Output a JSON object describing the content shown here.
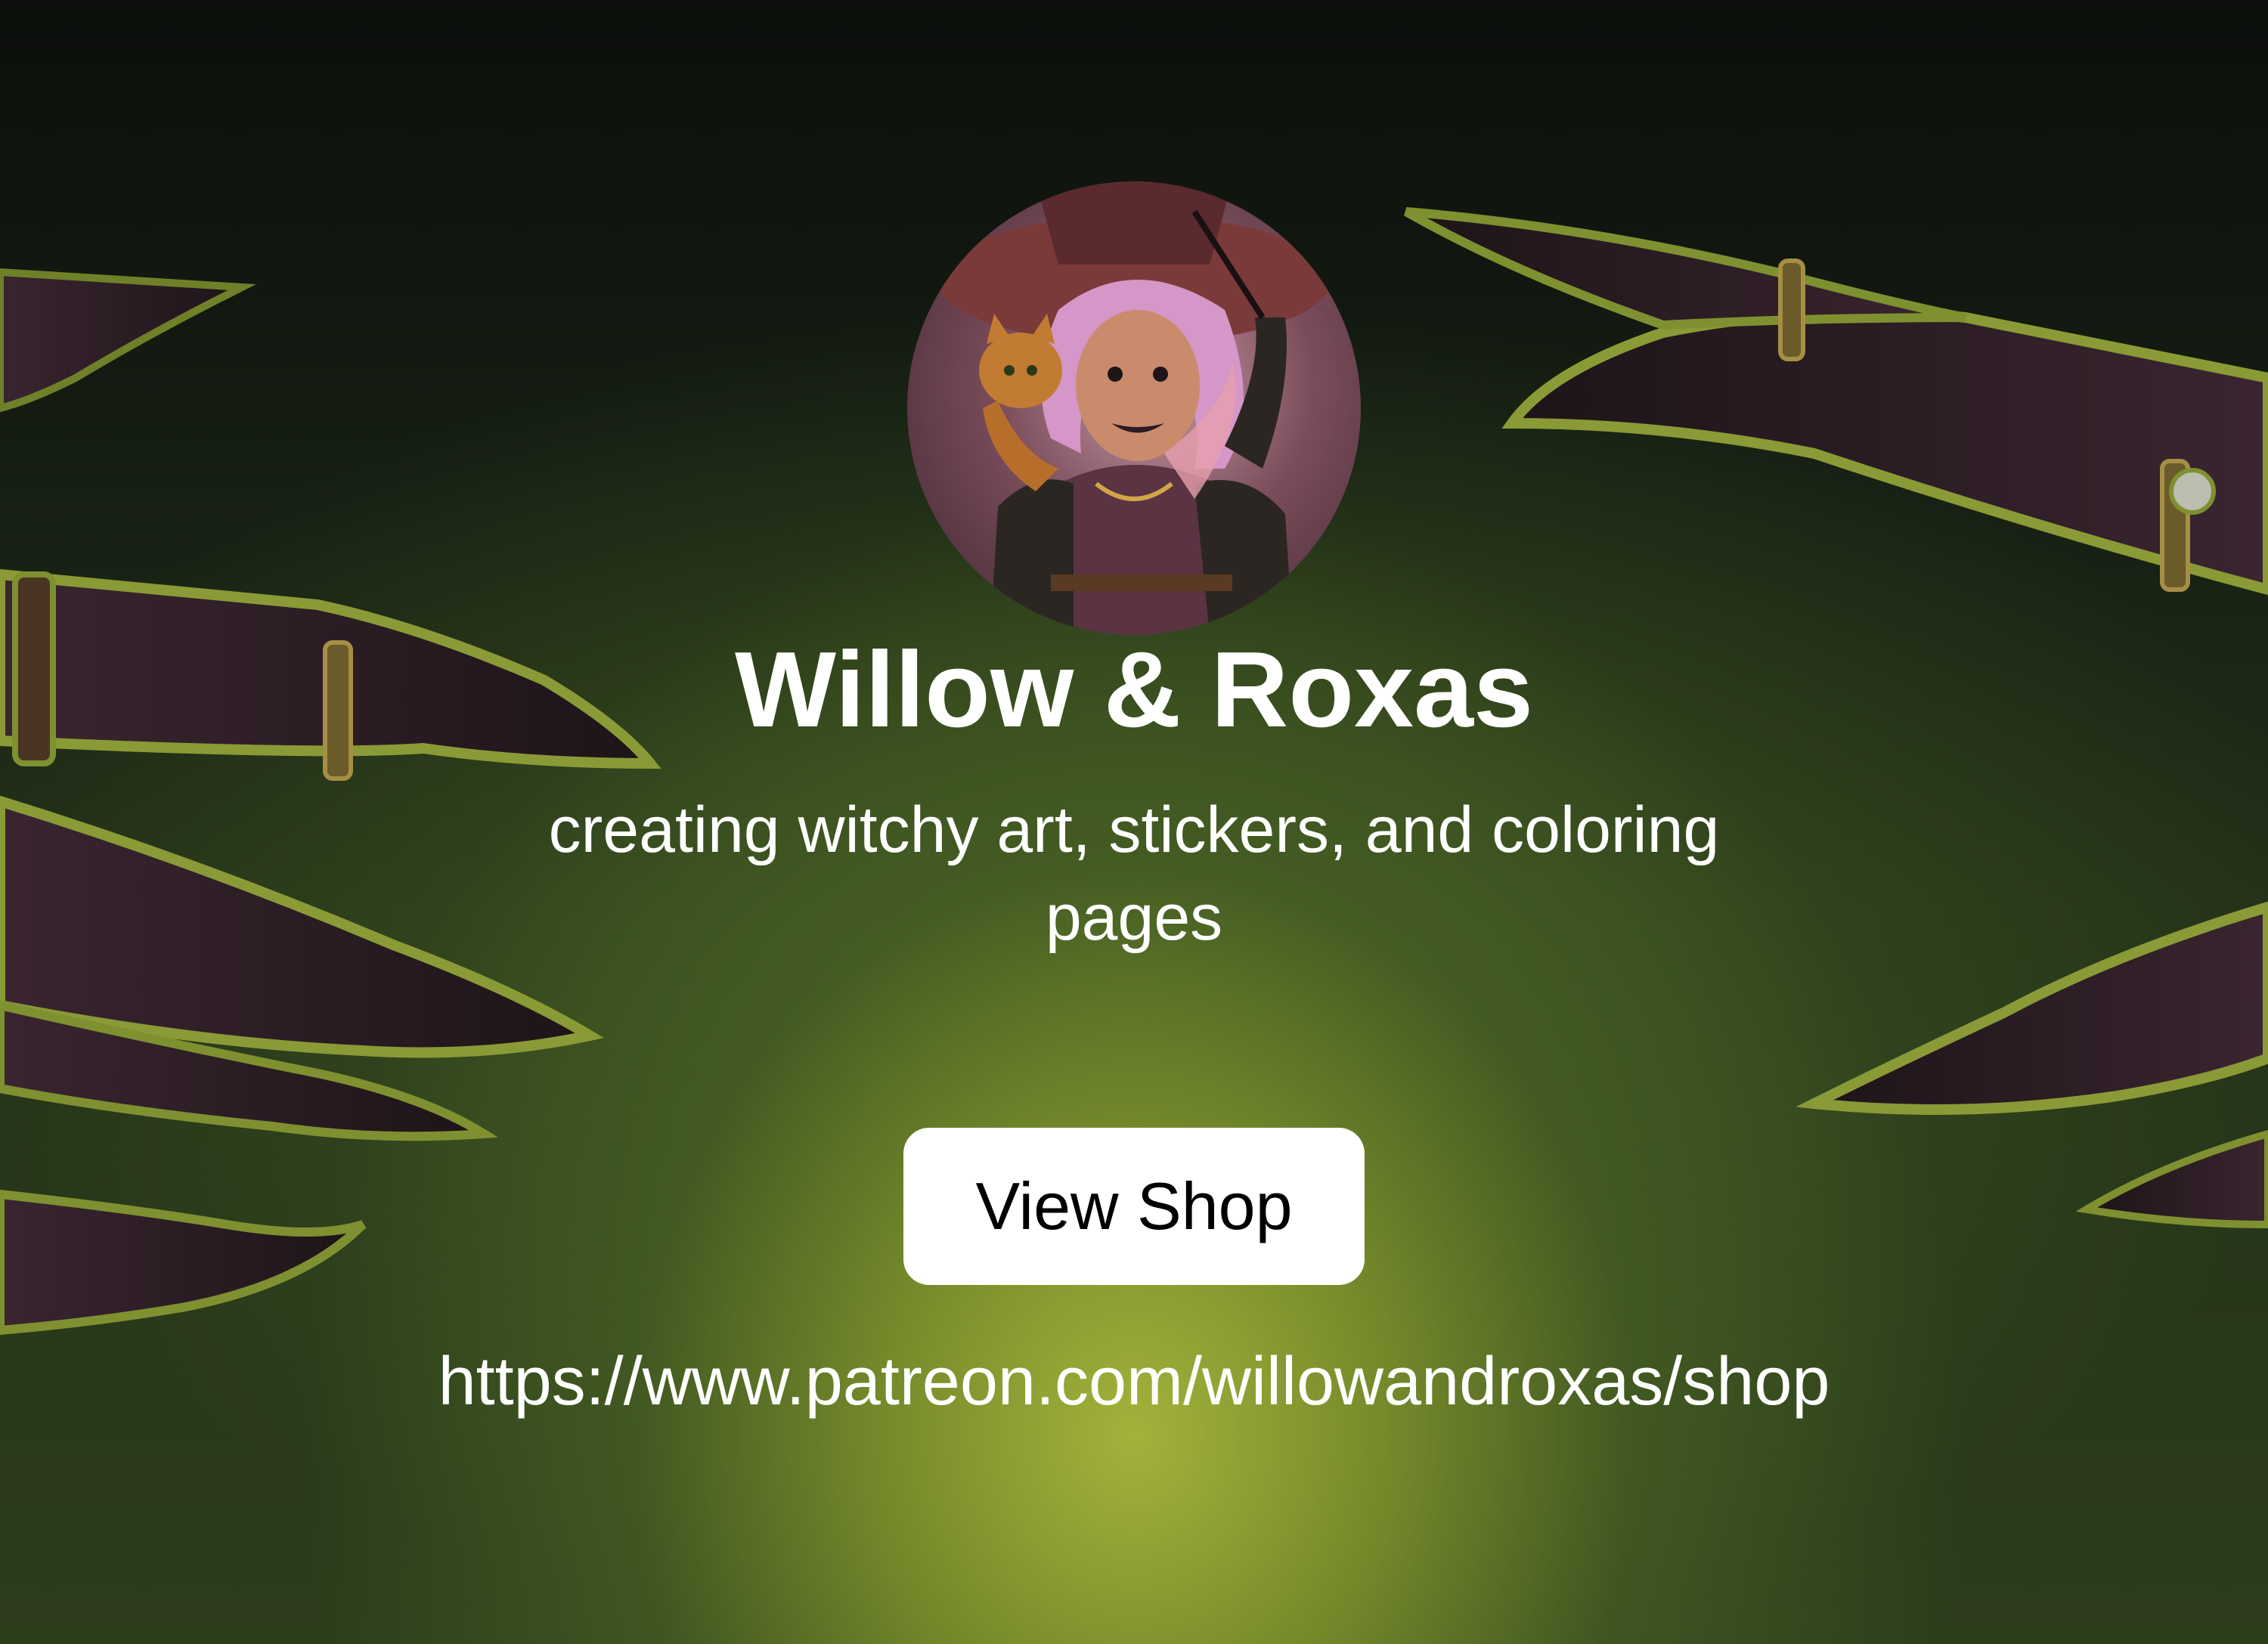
{
  "profile": {
    "name": "Willow & Roxas",
    "tagline": "creating witchy art, stickers, and coloring pages"
  },
  "button": {
    "label": "View Shop"
  },
  "link": {
    "url": "https://www.patreon.com/willowandroxas/shop"
  },
  "colors": {
    "text": "#ffffff",
    "button_bg": "#ffffff",
    "button_text": "#000000",
    "glow": "#aab83c",
    "background_dark": "#0e120c"
  },
  "icons": {
    "avatar": "witch-with-cat-avatar"
  }
}
